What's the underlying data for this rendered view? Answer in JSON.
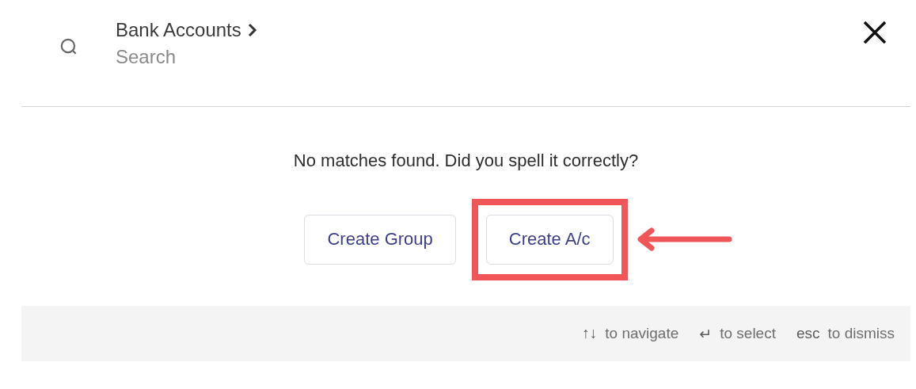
{
  "header": {
    "breadcrumb": "Bank Accounts",
    "search": {
      "placeholder": "Search"
    }
  },
  "message": "No matches found. Did you spell it correctly?",
  "buttons": [
    {
      "label": "Create Group",
      "highlighted": false
    },
    {
      "label": "Create A/c",
      "highlighted": true
    }
  ],
  "footer": {
    "hints": [
      {
        "keys": "↑↓",
        "text": "to navigate"
      },
      {
        "keys": "↵",
        "text": "to select"
      },
      {
        "keys": "esc",
        "text": "to dismiss"
      }
    ]
  }
}
